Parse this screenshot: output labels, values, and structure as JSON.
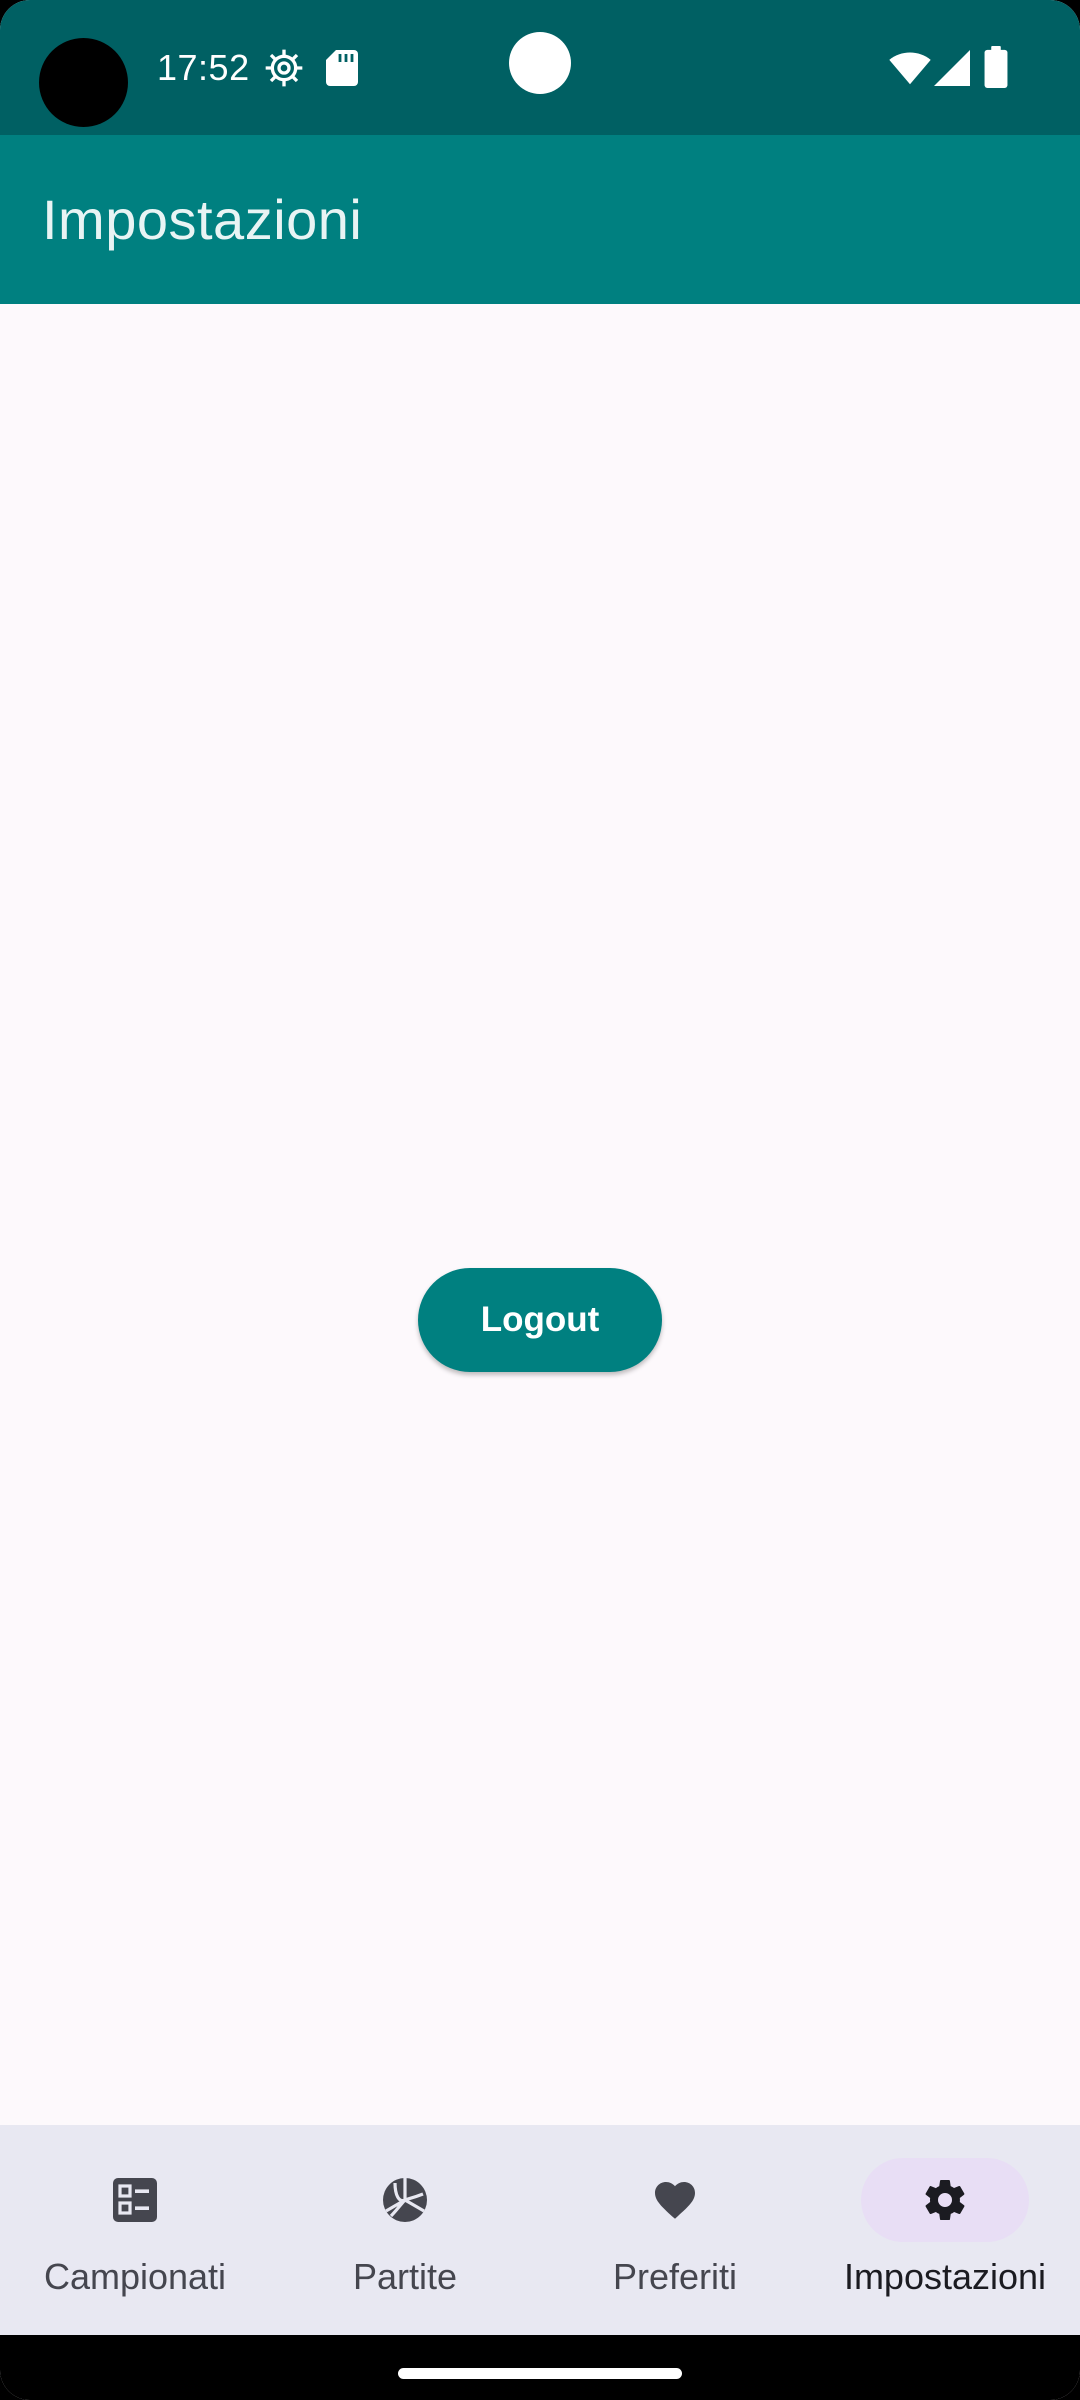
{
  "status_bar": {
    "time": "17:52",
    "icons": [
      "settings-gear-icon",
      "sd-card-icon",
      "wifi-icon",
      "cell-signal-icon",
      "battery-icon"
    ]
  },
  "app_bar": {
    "title": "Impostazioni"
  },
  "main": {
    "logout_label": "Logout"
  },
  "bottom_nav": {
    "items": [
      {
        "label": "Campionati",
        "icon": "championships-list-icon",
        "active": false
      },
      {
        "label": "Partite",
        "icon": "volleyball-icon",
        "active": false
      },
      {
        "label": "Preferiti",
        "icon": "heart-icon",
        "active": false
      },
      {
        "label": "Impostazioni",
        "icon": "gear-icon",
        "active": true
      }
    ]
  },
  "colors": {
    "status_bar": "#006063",
    "primary": "#008080",
    "background": "#FDF9FC",
    "nav_background": "#E8E8F2",
    "active_indicator": "#E8DEF5"
  }
}
